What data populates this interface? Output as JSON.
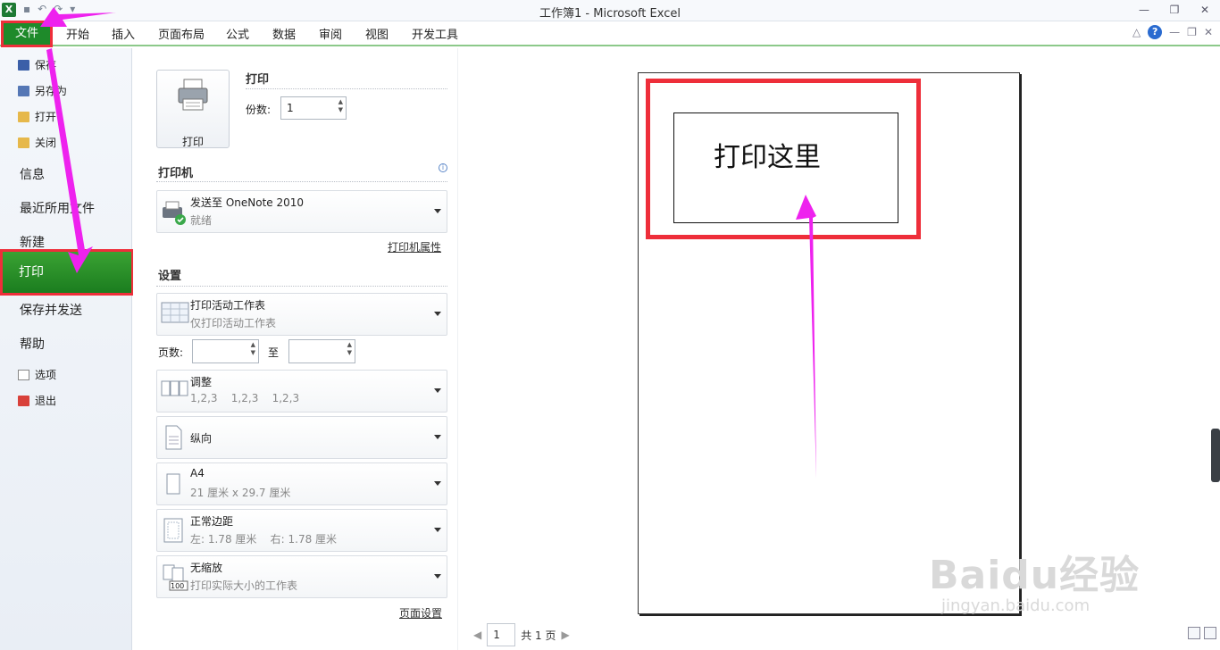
{
  "window": {
    "title": "工作簿1 - Microsoft Excel",
    "app_icon": "X"
  },
  "ribbon": {
    "tabs": [
      "文件",
      "开始",
      "插入",
      "页面布局",
      "公式",
      "数据",
      "审阅",
      "视图",
      "开发工具"
    ]
  },
  "backstage_nav": {
    "save": "保存",
    "save_as": "另存为",
    "open": "打开",
    "close": "关闭",
    "info": "信息",
    "recent": "最近所用文件",
    "new": "新建",
    "print": "打印",
    "save_send": "保存并发送",
    "help": "帮助",
    "options": "选项",
    "exit": "退出"
  },
  "print_panel": {
    "print_button": "打印",
    "print_section": "打印",
    "copies_label": "份数:",
    "copies_value": "1",
    "printer_section": "打印机",
    "printer_name": "发送至 OneNote 2010",
    "printer_status": "就绪",
    "printer_properties": "打印机属性",
    "settings_section": "设置",
    "what_title": "打印活动工作表",
    "what_sub": "仅打印活动工作表",
    "pages_label": "页数:",
    "pages_to": "至",
    "collate_title": "调整",
    "collate_sub": "1,2,3    1,2,3    1,2,3",
    "orientation": "纵向",
    "paper_title": "A4",
    "paper_sub": "21 厘米 x 29.7 厘米",
    "margins_title": "正常边距",
    "margins_sub": "左: 1.78 厘米    右: 1.78 厘米",
    "scaling_title": "无缩放",
    "scaling_sub": "打印实际大小的工作表",
    "page_setup": "页面设置"
  },
  "preview": {
    "cell_text": "打印这里",
    "current_page": "1",
    "total_pages": "共 1 页"
  },
  "watermark": {
    "line1": "Baidu经验",
    "line2": "jingyan.baidu.com"
  },
  "colors": {
    "file_tab": "#1e8a2a",
    "highlight_red": "#ee2e3a",
    "annotation_arrow": "#ee22ee"
  }
}
